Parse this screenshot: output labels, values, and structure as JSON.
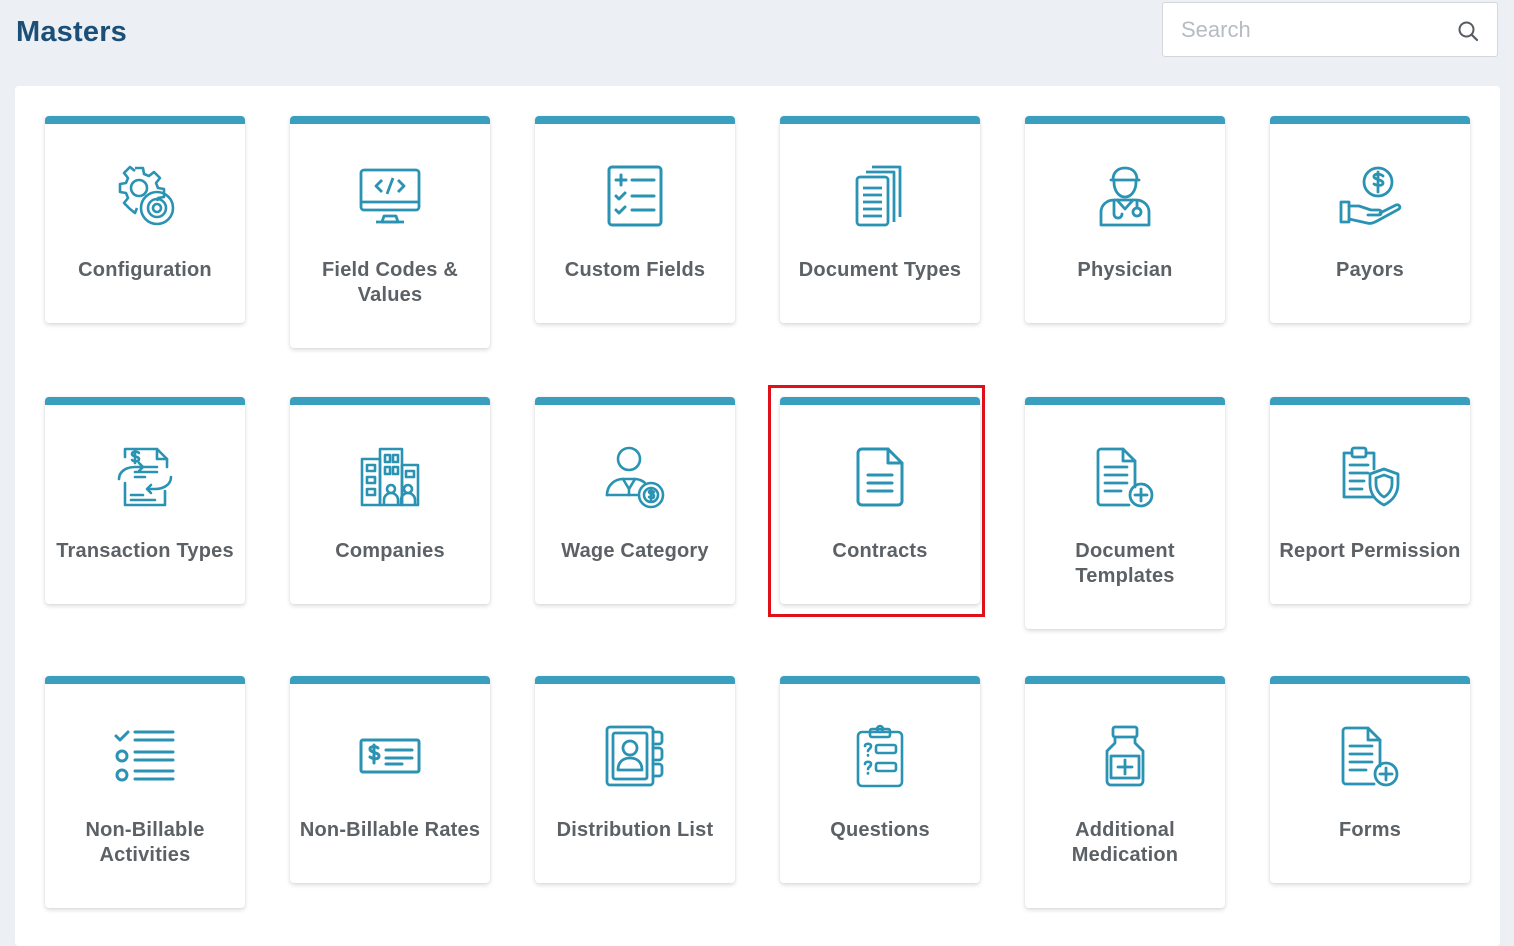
{
  "page": {
    "title": "Masters"
  },
  "search": {
    "placeholder": "Search",
    "value": ""
  },
  "colors": {
    "accent": "#3a9fbf",
    "title": "#1b4f78",
    "highlight": "#e0101a"
  },
  "tiles": [
    {
      "label": "Configuration",
      "icon": "gears-icon"
    },
    {
      "label": "Field Codes & Values",
      "icon": "code-monitor-icon"
    },
    {
      "label": "Custom Fields",
      "icon": "checklist-form-icon"
    },
    {
      "label": "Document Types",
      "icon": "documents-stack-icon"
    },
    {
      "label": "Physician",
      "icon": "doctor-icon"
    },
    {
      "label": "Payors",
      "icon": "hand-dollar-icon"
    },
    {
      "label": "Transaction Types",
      "icon": "transaction-exchange-icon"
    },
    {
      "label": "Companies",
      "icon": "buildings-icon"
    },
    {
      "label": "Wage Category",
      "icon": "person-dollar-icon"
    },
    {
      "label": "Contracts",
      "icon": "contract-document-icon"
    },
    {
      "label": "Document Templates",
      "icon": "document-add-icon"
    },
    {
      "label": "Report Permission",
      "icon": "report-shield-icon"
    },
    {
      "label": "Non-Billable Activities",
      "icon": "check-list-icon"
    },
    {
      "label": "Non-Billable Rates",
      "icon": "dollar-check-icon"
    },
    {
      "label": "Distribution List",
      "icon": "address-book-icon"
    },
    {
      "label": "Questions",
      "icon": "question-clipboard-icon"
    },
    {
      "label": "Additional Medication",
      "icon": "medicine-bottle-icon"
    },
    {
      "label": "Forms",
      "icon": "form-add-icon"
    }
  ],
  "selected_tile": "Contracts"
}
